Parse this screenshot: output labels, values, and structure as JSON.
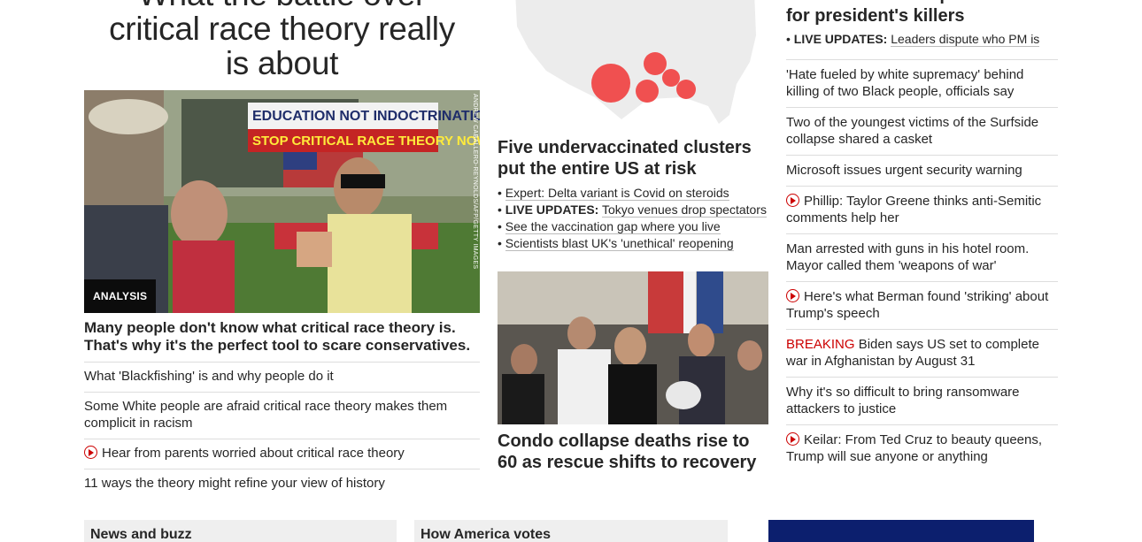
{
  "col1": {
    "headline_partial": "What the battle over",
    "headline_lines": [
      "critical race theory really",
      "is about"
    ],
    "image_credit": "ANDREW CABALLERO-REYNOLDS/AFP/GETTY IMAGES",
    "sign_text": [
      "EDUCATION NOT INDOCTRINATION",
      "STOP CRITICAL RACE THEORY NOW!"
    ],
    "tag": "ANALYSIS",
    "lead_title": "Many people don't know what critical race theory is. That's why it's the perfect tool to scare conservatives.",
    "items": [
      {
        "text": "What 'Blackfishing' is and why people do it",
        "video": false
      },
      {
        "text": "Some White people are afraid critical race theory makes them complicit in racism",
        "video": false
      },
      {
        "text": "Hear from parents worried about critical race theory",
        "video": true
      },
      {
        "text": "11 ways the theory might refine your view of history",
        "video": false
      }
    ]
  },
  "col2": {
    "title": "Five undervaccinated clusters put the entire US at risk",
    "bullets": [
      {
        "prefix": "",
        "text": "Expert: Delta variant is Covid on steroids"
      },
      {
        "prefix": "LIVE UPDATES:",
        "text": "Tokyo venues drop spectators"
      },
      {
        "prefix": "",
        "text": "See the vaccination gap where you live"
      },
      {
        "prefix": "",
        "text": "Scientists blast UK's 'unethical' reopening"
      }
    ],
    "title2": "Condo collapse deaths rise to 60 as rescue shifts to recovery",
    "map_color": "#f05050"
  },
  "col3": {
    "top_headline": "Haiti in turmoil as police hunt for president's killers",
    "top_update_prefix": "LIVE UPDATES:",
    "top_update_text": "Leaders dispute who PM is",
    "items": [
      {
        "text": "'Hate fueled by white supremacy' behind killing of two Black people, officials say",
        "video": false,
        "breaking": ""
      },
      {
        "text": "Two of the youngest victims of the Surfside collapse shared a casket",
        "video": false,
        "breaking": ""
      },
      {
        "text": "Microsoft issues urgent security warning",
        "video": false,
        "breaking": ""
      },
      {
        "text": "Phillip: Taylor Greene thinks anti-Semitic comments help her",
        "video": true,
        "breaking": ""
      },
      {
        "text": "Man arrested with guns in his hotel room. Mayor called them 'weapons of war'",
        "video": false,
        "breaking": ""
      },
      {
        "text": "Here's what Berman found 'striking' about Trump's speech",
        "video": true,
        "breaking": ""
      },
      {
        "text": "Biden says US set to complete war in Afghanistan by August 31",
        "video": false,
        "breaking": "BREAKING"
      },
      {
        "text": "Why it's so difficult to bring ransomware attackers to justice",
        "video": false,
        "breaking": ""
      },
      {
        "text": "Keilar: From Ted Cruz to beauty queens, Trump will sue anyone or anything",
        "video": true,
        "breaking": ""
      }
    ]
  },
  "bottom": {
    "box1": "News and buzz",
    "box2": "How America votes"
  },
  "colors": {
    "accent": "#cc0000",
    "text": "#262626",
    "divider": "#dddddd"
  }
}
